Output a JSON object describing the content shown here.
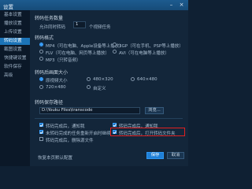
{
  "window": {
    "title": "设置",
    "minimize_glyph": "–",
    "close_glyph": "×"
  },
  "sidebar": {
    "items": [
      {
        "label": "基本设置"
      },
      {
        "label": "播放设置"
      },
      {
        "label": "上传设置"
      },
      {
        "label": "转码设置"
      },
      {
        "label": "截图设置"
      },
      {
        "label": "快捷键设置"
      },
      {
        "label": "软件保存"
      },
      {
        "label": "高级"
      }
    ],
    "active_index": 3
  },
  "task": {
    "section_title": "转码任务数量",
    "prefix": "允许同时转码",
    "count": "1",
    "suffix": "个视频任务"
  },
  "format": {
    "section_title": "转码格式",
    "options": [
      {
        "label": "MP4（可在电脑、Apple设备等上播放）",
        "selected": true
      },
      {
        "label": "FLV（可在电脑、网页等上播放）",
        "selected": false
      },
      {
        "label": "MP3（只转音频）",
        "selected": false
      },
      {
        "label": "3GP（可在手机、PSP等上播放）",
        "selected": false
      },
      {
        "label": "AVI（可在电脑等上播放）",
        "selected": false
      }
    ]
  },
  "size": {
    "section_title": "转码后画面大小",
    "options": [
      {
        "label": "原视频大小",
        "selected": true
      },
      {
        "label": "480×320",
        "selected": false
      },
      {
        "label": "640×480",
        "selected": false
      },
      {
        "label": "720×480",
        "selected": false
      },
      {
        "label": "自定义",
        "selected": false
      }
    ]
  },
  "path": {
    "section_title": "转码保存路径",
    "value": "D:\\Youku Files\\transcode",
    "browse_label": "浏览..."
  },
  "options": [
    {
      "label": "转码完成后，通知我",
      "checked": true
    },
    {
      "label": "转码完成后，通知我",
      "checked": true
    },
    {
      "label": "未转码完成的任务重新开启时继续",
      "checked": true
    },
    {
      "label": "转码完成后，打开转码文件夹",
      "checked": true
    },
    {
      "label": "转码完成后，删除源文件",
      "checked": false
    }
  ],
  "footer": {
    "note": "恢复本页默认配置",
    "save_label": "保存",
    "cancel_label": "取消"
  },
  "colors": {
    "accent": "#1f80d8",
    "highlight": "#e02020"
  }
}
